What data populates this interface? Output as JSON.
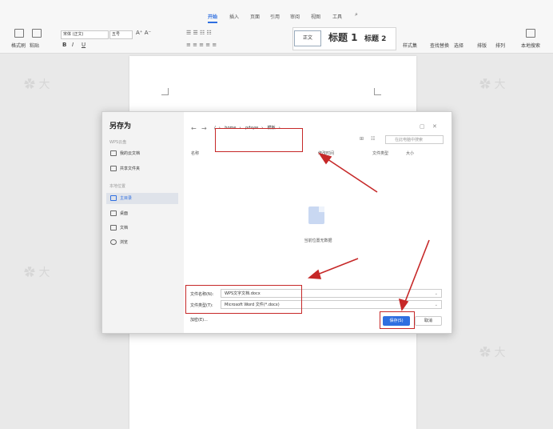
{
  "menu_tabs": [
    {
      "label": "开始",
      "active": true
    },
    {
      "label": "插入"
    },
    {
      "label": "页面"
    },
    {
      "label": "引用"
    },
    {
      "label": "审阅"
    },
    {
      "label": "视图"
    },
    {
      "label": "工具"
    }
  ],
  "ribbon": {
    "format_painter": "格式刷",
    "paste": "粘贴",
    "font_name": "宋体 (正文)",
    "font_size": "五号",
    "styles": {
      "normal": "正文",
      "h1": "标题 1",
      "h2": "标题 2"
    },
    "style_set": "样式集",
    "find_replace": "查找替换",
    "select": "选择",
    "sort": "排版",
    "arrange": "排列",
    "local_search": "本地搜索"
  },
  "dialog": {
    "title": "另存为",
    "sidebar": {
      "section_wps": "WPS云盘",
      "cloud_docs": "我的云文档",
      "shared_folder": "共享文件夹",
      "section_local": "本地位置",
      "items": [
        {
          "label": "主目录",
          "selected": true
        },
        {
          "label": "桌面"
        },
        {
          "label": "文档"
        },
        {
          "label": "浏览"
        }
      ]
    },
    "path": [
      "/",
      "home",
      "pdsyw",
      "模板"
    ],
    "search_placeholder": "在此电脑中搜索",
    "columns": {
      "name": "名称",
      "modified": "修改时间",
      "type": "文件类型",
      "size": "大小"
    },
    "empty_text": "当前位置无数据",
    "filename_label": "文件名称(N):",
    "filename_value": "WPS文字文档.docx",
    "filetype_label": "文件类型(T):",
    "filetype_value": "Microsoft Word 文件(*.docx)",
    "encrypt_label": "加密(E)...",
    "save_label": "保存(S)",
    "cancel_label": "取消"
  },
  "colors": {
    "accent": "#2f6fe0",
    "annotation": "#c62828"
  }
}
